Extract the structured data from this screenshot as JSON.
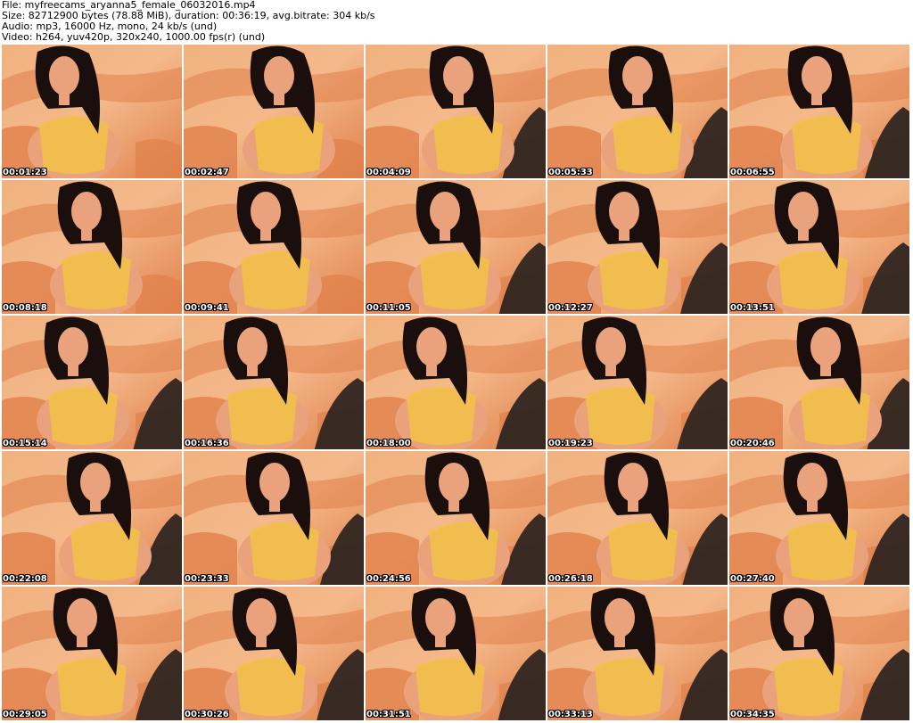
{
  "header": {
    "file": "File: myfreecams_aryanna5_female_06032016.mp4",
    "size": "Size: 82712900 bytes (78.88 MiB), duration: 00:36:19, avg.bitrate: 304 kb/s",
    "audio": "Audio: mp3, 16000 Hz, mono, 24 kb/s (und)",
    "video": "Video: h264, yuv420p, 320x240, 1000.00 fps(r) (und)"
  },
  "colors": {
    "background": "#ffffff",
    "sofa_orange": "#e0804a",
    "sofa_highlight": "#f4b88a",
    "wall": "#f0b27f",
    "hair": "#1a0f0c",
    "skin": "#e9a27c",
    "lingerie": "#f2c247",
    "stocking": "#2a2220",
    "timestamp_text": "#ffffff",
    "timestamp_outline": "#000000"
  },
  "thumbnails": [
    {
      "time": "00:01:23"
    },
    {
      "time": "00:02:47"
    },
    {
      "time": "00:04:09"
    },
    {
      "time": "00:05:33"
    },
    {
      "time": "00:06:55"
    },
    {
      "time": "00:08:18"
    },
    {
      "time": "00:09:41"
    },
    {
      "time": "00:11:05"
    },
    {
      "time": "00:12:27"
    },
    {
      "time": "00:13:51"
    },
    {
      "time": "00:15:14"
    },
    {
      "time": "00:16:36"
    },
    {
      "time": "00:18:00"
    },
    {
      "time": "00:19:23"
    },
    {
      "time": "00:20:46"
    },
    {
      "time": "00:22:08"
    },
    {
      "time": "00:23:33"
    },
    {
      "time": "00:24:56"
    },
    {
      "time": "00:26:18"
    },
    {
      "time": "00:27:40"
    },
    {
      "time": "00:29:05"
    },
    {
      "time": "00:30:26"
    },
    {
      "time": "00:31:51"
    },
    {
      "time": "00:33:13"
    },
    {
      "time": "00:34:35"
    }
  ]
}
